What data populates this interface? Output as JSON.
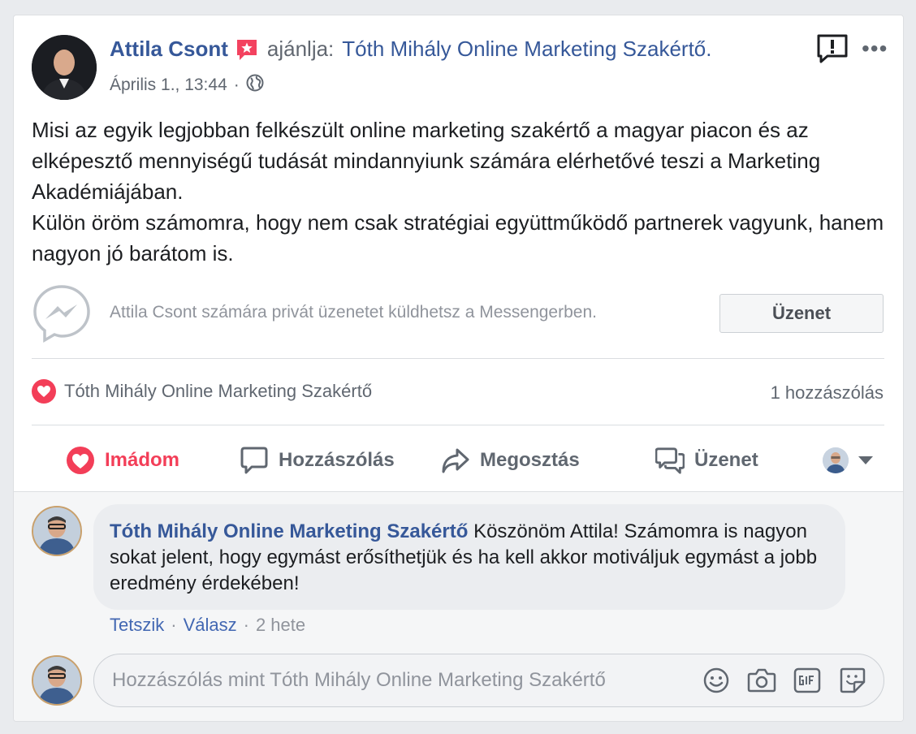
{
  "post": {
    "author": "Attila Csont",
    "verb": "ajánlja:",
    "page_name": "Tóth Mihály Online Marketing Szakértő.",
    "date": "Április 1., 13:44",
    "date_sep": "·",
    "privacy_icon": "globe-icon",
    "paragraph_1": "Misi az egyik legjobban felkészült online marketing szakértő a magyar piacon és az elképesztő mennyiségű tudását mindannyiunk számára elérhetővé teszi a Marketing Akadémiájában.",
    "paragraph_2": "Külön öröm számomra, hogy nem csak stratégiai együttműködő partnerek vagyunk, hanem nagyon jó barátom is.",
    "more_label": "•••"
  },
  "messenger": {
    "prompt": "Attila Csont számára privát üzenetet küldhetsz a Messengerben.",
    "button_label": "Üzenet"
  },
  "reactions": {
    "reactor": "Tóth Mihály Online Marketing Szakértő",
    "comment_count": "1 hozzászólás"
  },
  "actions": {
    "love": "Imádom",
    "comment": "Hozzászólás",
    "share": "Megosztás",
    "message": "Üzenet"
  },
  "comment": {
    "author": "Tóth Mihály Online Marketing Szakértő",
    "text": "Köszönöm Attila! Számomra is nagyon sokat jelent, hogy egymást erősíthetjük és ha kell akkor motiváljuk egymást a jobb eredmény érdekében!",
    "like": "Tetszik",
    "reply": "Válasz",
    "time": "2 hete",
    "sep": "·"
  },
  "reply_box": {
    "placeholder": "Hozzászólás mint Tóth Mihály Online Marketing Szakértő"
  },
  "colors": {
    "link": "#365899",
    "love": "#f33e58",
    "muted": "#606770"
  }
}
